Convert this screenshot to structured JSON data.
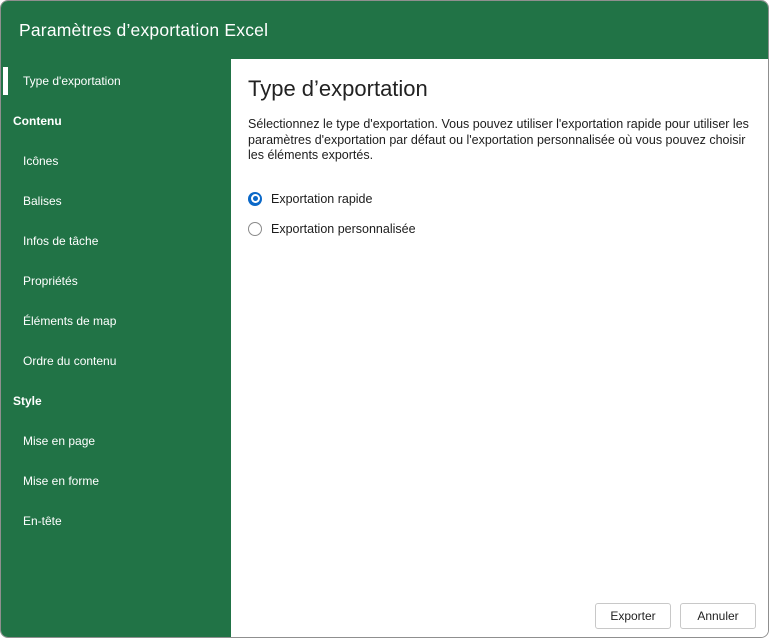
{
  "dialog": {
    "title": "Paramètres d’exportation Excel"
  },
  "sidebar": {
    "items": [
      {
        "label": "Type d'exportation",
        "type": "item",
        "selected": true
      },
      {
        "label": "Contenu",
        "type": "section"
      },
      {
        "label": "Icônes",
        "type": "item"
      },
      {
        "label": "Balises",
        "type": "item"
      },
      {
        "label": "Infos de tâche",
        "type": "item"
      },
      {
        "label": "Propriétés",
        "type": "item"
      },
      {
        "label": "Éléments de map",
        "type": "item"
      },
      {
        "label": "Ordre du contenu",
        "type": "item"
      },
      {
        "label": "Style",
        "type": "section"
      },
      {
        "label": "Mise en page",
        "type": "item"
      },
      {
        "label": "Mise en forme",
        "type": "item"
      },
      {
        "label": "En-tête",
        "type": "item"
      }
    ]
  },
  "main": {
    "title": "Type d’exportation",
    "description": "Sélectionnez le type d'exportation. Vous pouvez utiliser l'exportation rapide pour utiliser les paramètres d'exportation par défaut ou l'exportation personnalisée où vous pouvez choisir les éléments exportés.",
    "options": [
      {
        "label": "Exportation rapide",
        "selected": true
      },
      {
        "label": "Exportation personnalisée",
        "selected": false
      }
    ]
  },
  "footer": {
    "export_label": "Exporter",
    "cancel_label": "Annuler"
  },
  "colors": {
    "brand_green": "#217346",
    "radio_accent": "#0a68c8",
    "header_text": "#ffffff",
    "button_border": "#c8c8c8"
  }
}
